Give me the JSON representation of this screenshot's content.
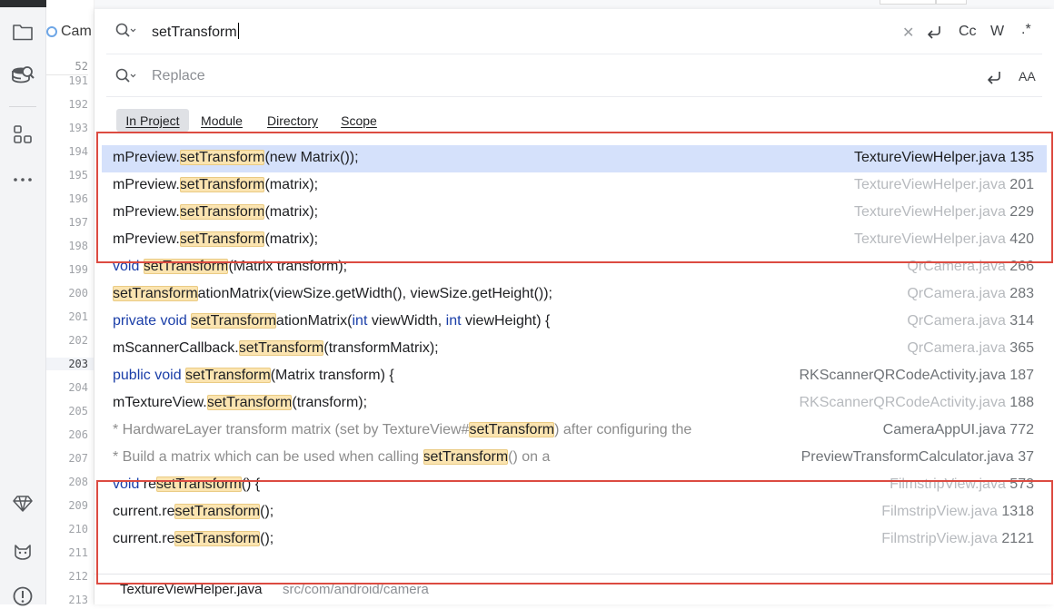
{
  "editor": {
    "tab_label": "Cam",
    "gutter": {
      "top_line": "52",
      "lines": [
        "191",
        "192",
        "193",
        "194",
        "195",
        "196",
        "197",
        "198",
        "199",
        "200",
        "201",
        "202",
        "203",
        "204",
        "205",
        "206",
        "207",
        "208",
        "209",
        "210",
        "211",
        "212",
        "213"
      ],
      "current_line": "203"
    }
  },
  "find": {
    "search_value": "setTransform",
    "replace_placeholder": "Replace",
    "options": {
      "case_label": "Cc",
      "word_label": "W",
      "regex_label": ".*",
      "preserve_case_label": "AA"
    },
    "scope_tabs": [
      {
        "label": "In Project",
        "active": true
      },
      {
        "label": "Module",
        "active": false
      },
      {
        "label": "Directory",
        "active": false
      },
      {
        "label": "Scope",
        "active": false
      }
    ],
    "results": [
      {
        "parts": [
          {
            "t": "mPreview."
          },
          {
            "t": "setTransform",
            "c": "hl"
          },
          {
            "t": "(new Matrix());"
          }
        ],
        "file": "TextureViewHelper.java",
        "line": "135",
        "selected": true
      },
      {
        "parts": [
          {
            "t": "mPreview."
          },
          {
            "t": "setTransform",
            "c": "hl"
          },
          {
            "t": "(matrix);"
          }
        ],
        "file": "TextureViewHelper.java",
        "line": "201"
      },
      {
        "parts": [
          {
            "t": "mPreview."
          },
          {
            "t": "setTransform",
            "c": "hl"
          },
          {
            "t": "(matrix);"
          }
        ],
        "file": "TextureViewHelper.java",
        "line": "229"
      },
      {
        "parts": [
          {
            "t": "mPreview."
          },
          {
            "t": "setTransform",
            "c": "hl"
          },
          {
            "t": "(matrix);"
          }
        ],
        "file": "TextureViewHelper.java",
        "line": "420"
      },
      {
        "parts": [
          {
            "t": "void ",
            "c": "kw"
          },
          {
            "t": "setTransform",
            "c": "hl"
          },
          {
            "t": "(Matrix transform);"
          }
        ],
        "file": "QrCamera.java",
        "line": "266"
      },
      {
        "parts": [
          {
            "t": "setTransform",
            "c": "hl"
          },
          {
            "t": "ationMatrix(viewSize.getWidth(), viewSize.getHeight());"
          }
        ],
        "file": "QrCamera.java",
        "line": "283"
      },
      {
        "parts": [
          {
            "t": "private void ",
            "c": "kw"
          },
          {
            "t": "setTransform",
            "c": "hl"
          },
          {
            "t": "ationMatrix("
          },
          {
            "t": "int ",
            "c": "kw"
          },
          {
            "t": "viewWidth, "
          },
          {
            "t": "int ",
            "c": "kw"
          },
          {
            "t": "viewHeight) {"
          }
        ],
        "file": "QrCamera.java",
        "line": "314"
      },
      {
        "parts": [
          {
            "t": "mScannerCallback."
          },
          {
            "t": "setTransform",
            "c": "hl"
          },
          {
            "t": "(transformMatrix);"
          }
        ],
        "file": "QrCamera.java",
        "line": "365"
      },
      {
        "parts": [
          {
            "t": "public void ",
            "c": "kw"
          },
          {
            "t": "setTransform",
            "c": "hl"
          },
          {
            "t": "(Matrix transform) {"
          }
        ],
        "file": "RKScannerQRCodeActivity.java",
        "line": "187",
        "dark": true
      },
      {
        "parts": [
          {
            "t": "mTextureView."
          },
          {
            "t": "setTransform",
            "c": "hl"
          },
          {
            "t": "(transform);"
          }
        ],
        "file": "RKScannerQRCodeActivity.java",
        "line": "188"
      },
      {
        "parts": [
          {
            "t": "* HardwareLayer transform matrix (set by TextureView#",
            "c": "cm"
          },
          {
            "t": "setTransform",
            "c": "hl"
          },
          {
            "t": ") after configuring the",
            "c": "cm"
          }
        ],
        "file": "CameraAppUI.java",
        "line": "772",
        "dark": true
      },
      {
        "parts": [
          {
            "t": "* Build a matrix which can be used when calling ",
            "c": "cm"
          },
          {
            "t": "setTransform",
            "c": "hl"
          },
          {
            "t": "() on a",
            "c": "cm"
          }
        ],
        "file": "PreviewTransformCalculator.java",
        "line": "37",
        "dark": true
      },
      {
        "parts": [
          {
            "t": "void ",
            "c": "kw"
          },
          {
            "t": "re"
          },
          {
            "t": "setTransform",
            "c": "hl"
          },
          {
            "t": "() {"
          }
        ],
        "file": "FilmstripView.java",
        "line": "573"
      },
      {
        "parts": [
          {
            "t": "current.re"
          },
          {
            "t": "setTransform",
            "c": "hl"
          },
          {
            "t": "();"
          }
        ],
        "file": "FilmstripView.java",
        "line": "1318"
      },
      {
        "parts": [
          {
            "t": "current.re"
          },
          {
            "t": "setTransform",
            "c": "hl"
          },
          {
            "t": "();"
          }
        ],
        "file": "FilmstripView.java",
        "line": "2121"
      }
    ],
    "preview": {
      "file": "TextureViewHelper.java",
      "path": "src/com/android/camera"
    }
  },
  "colors": {
    "selection": "#d5e1fb",
    "highlight": "#fbe4b0",
    "keyword": "#1a3ea8",
    "annotation_red": "#dc4b41"
  }
}
